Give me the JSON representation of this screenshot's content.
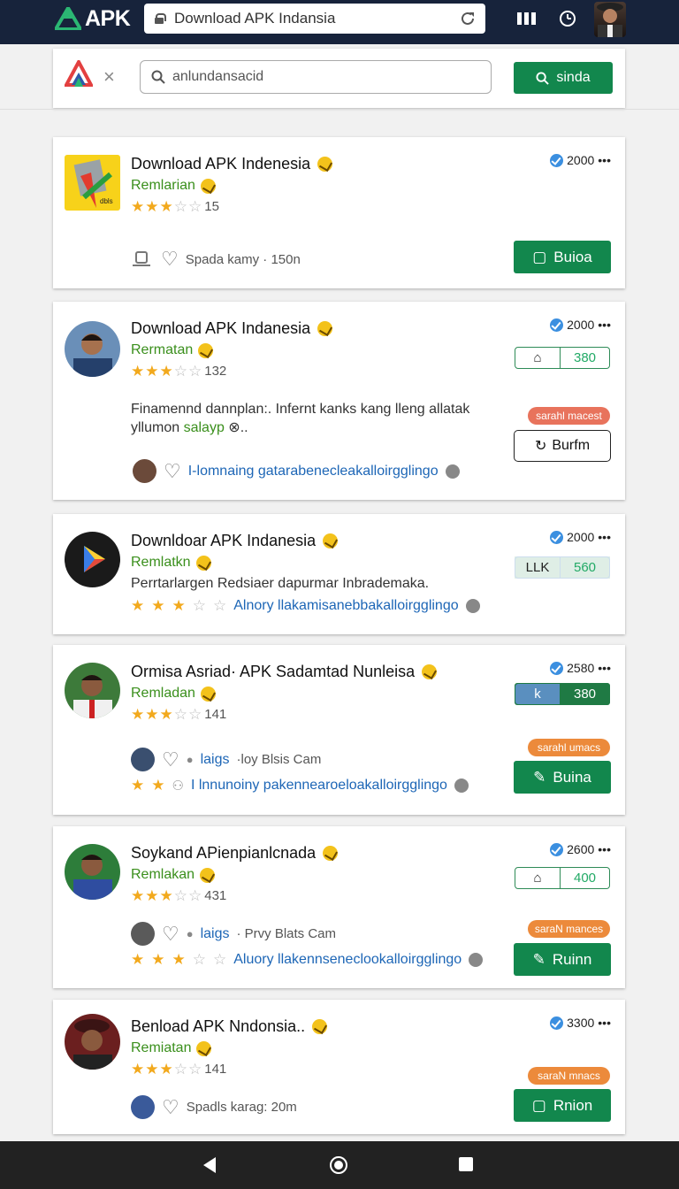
{
  "browser": {
    "brand": "APK",
    "url": "Download APK Indansia"
  },
  "search": {
    "value": "anlundansacid",
    "button": "sinda"
  },
  "cards": [
    {
      "title": "Download APK Indenesia",
      "sub": "Remlarian",
      "rating_count": "15",
      "count": "2000",
      "meta": "Spada kamy · 150n",
      "button": "Buioa"
    },
    {
      "title": "Download APK Indanesia",
      "sub": "Rermatan",
      "rating_count": "132",
      "count": "2000",
      "seg": "380",
      "desc1": "Finamennd dannplan:. Infernt kanks kang lleng allatak",
      "desc2": "yllumon",
      "desc2_green": "salayp",
      "pill": "sarahl macest",
      "meta": "I-lomnaing gatarabeneclea­kalloirgglingo",
      "button": "Burfm"
    },
    {
      "title": "Downldoar APK Indanesia",
      "sub": "Remlatkn",
      "count": "2000",
      "seg_a": "LLK",
      "seg_b": "560",
      "desc1": "Perrtarlargen Redsiaer dapurmar Inbrademaka.",
      "meta": "Alnory llakamisanebbakalloirgglingo"
    },
    {
      "title": "Ormisa Asriad· APK Sadamtad Nunleisa",
      "sub": "Remladan",
      "rating_count": "141",
      "count": "2580",
      "seg_a": "k",
      "seg_b": "380",
      "pill": "sarahl umacs",
      "meta_small": "laigs",
      "meta_small2": "·loy Blsis Cam",
      "meta": "I lnnunoiny pakennearoeloakalloirgglingo",
      "button": "Buina"
    },
    {
      "title": "Soykand APienpianlcnada",
      "sub": "Remlakan",
      "rating_count": "431",
      "count": "2600",
      "seg": "400",
      "pill": "saraN mances",
      "meta_small": "laigs",
      "meta_small2": "· Prvy Blats Cam",
      "meta": "Aluory llakennseneclookalloirgglingo",
      "button": "Ruinn"
    },
    {
      "title": "Benload APK Nndonsia..",
      "sub": "Remiatan",
      "rating_count": "141",
      "count": "3300",
      "pill": "saraN mnacs",
      "meta": "Spadls karag:  20m",
      "button": "Rnion"
    }
  ],
  "icons": {
    "reload": "reload-icon",
    "bars": "bars-icon",
    "clock": "clock-icon",
    "user": "user-avatar"
  }
}
